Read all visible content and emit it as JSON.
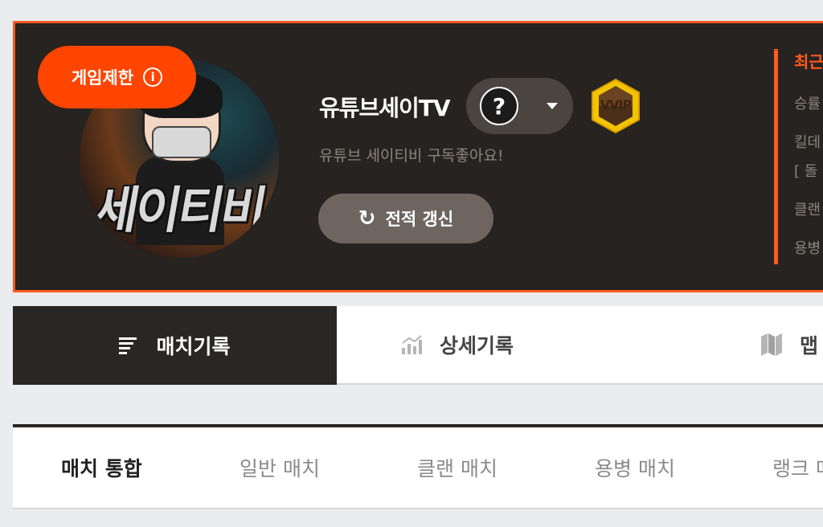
{
  "profile": {
    "restriction_badge": "게임제한",
    "avatar_art_text": "세이티비",
    "nickname": "유튜브세이TV",
    "help_symbol": "?",
    "vip_badge": "VVIP",
    "intro": "유튜브 세이티비 구독좋아요!",
    "refresh_label": "전적 갱신",
    "accent_color": "#ff5a1f"
  },
  "recent_panel": {
    "title": "최근",
    "rows": [
      "승률",
      "킬데",
      "[ 돌",
      "클랜",
      "용병"
    ]
  },
  "main_tabs": [
    {
      "label": "매치기록",
      "icon": "list-icon",
      "active": true
    },
    {
      "label": "상세기록",
      "icon": "stats-chart-icon",
      "active": false
    },
    {
      "label": "맵",
      "icon": "map-icon",
      "active": false
    }
  ],
  "sub_tabs": [
    {
      "label": "매치 통합",
      "active": true
    },
    {
      "label": "일반 매치",
      "active": false
    },
    {
      "label": "클랜 매치",
      "active": false
    },
    {
      "label": "용병 매치",
      "active": false
    },
    {
      "label": "랭크 매",
      "active": false
    }
  ]
}
